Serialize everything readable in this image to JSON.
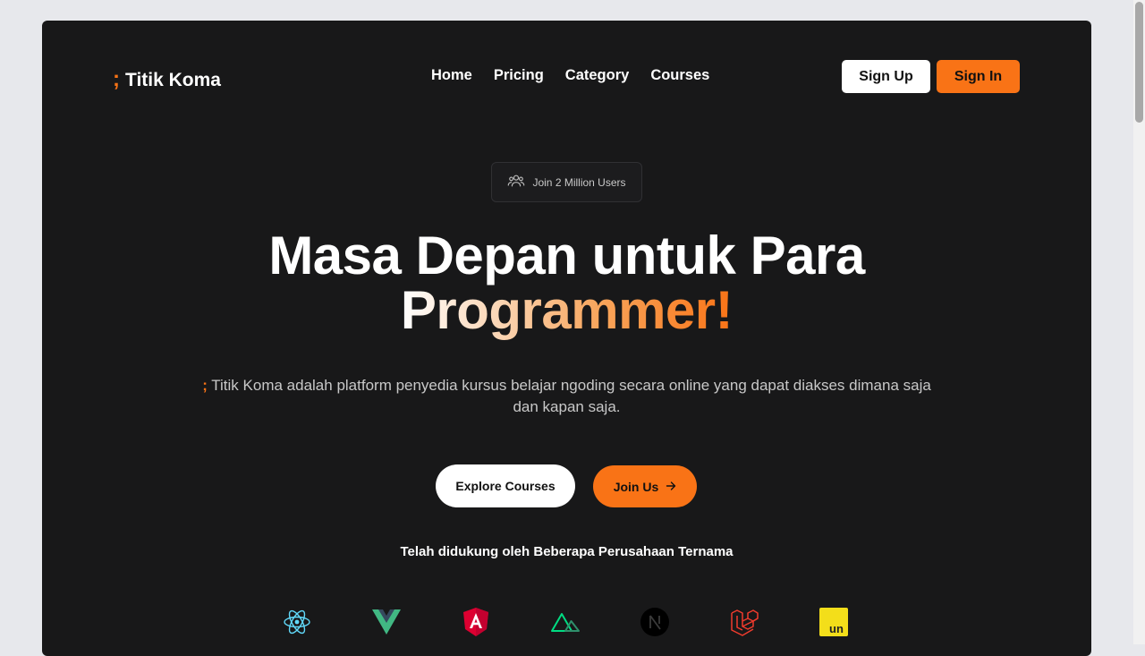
{
  "brand": {
    "mark": ";",
    "name": "Titik Koma"
  },
  "nav": {
    "links": [
      {
        "label": "Home"
      },
      {
        "label": "Pricing"
      },
      {
        "label": "Category"
      },
      {
        "label": "Courses"
      }
    ],
    "signup_label": "Sign Up",
    "signin_label": "Sign In"
  },
  "badge": {
    "icon": "users-icon",
    "text": "Join 2 Million Users"
  },
  "hero": {
    "title_line1": "Masa Depan untuk Para",
    "title_line2": "Programmer!",
    "subtitle_mark": ";",
    "subtitle": "Titik Koma adalah platform penyedia kursus belajar ngoding secara online yang dapat diakses dimana saja dan kapan saja.",
    "explore_label": "Explore Courses",
    "join_label": "Join Us"
  },
  "supported_text": "Telah didukung oleh Beberapa Perusahaan Ternama",
  "partner_logos": [
    {
      "icon": "react-logo-icon"
    },
    {
      "icon": "vue-logo-icon"
    },
    {
      "icon": "angular-logo-icon"
    },
    {
      "icon": "nuxt-logo-icon"
    },
    {
      "icon": "nextjs-logo-icon",
      "text": "N"
    },
    {
      "icon": "laravel-logo-icon"
    },
    {
      "icon": "unocss-logo-icon",
      "text": "un"
    }
  ],
  "colors": {
    "accent": "#f97316",
    "background": "#181819",
    "page": "#e7e8ec"
  }
}
